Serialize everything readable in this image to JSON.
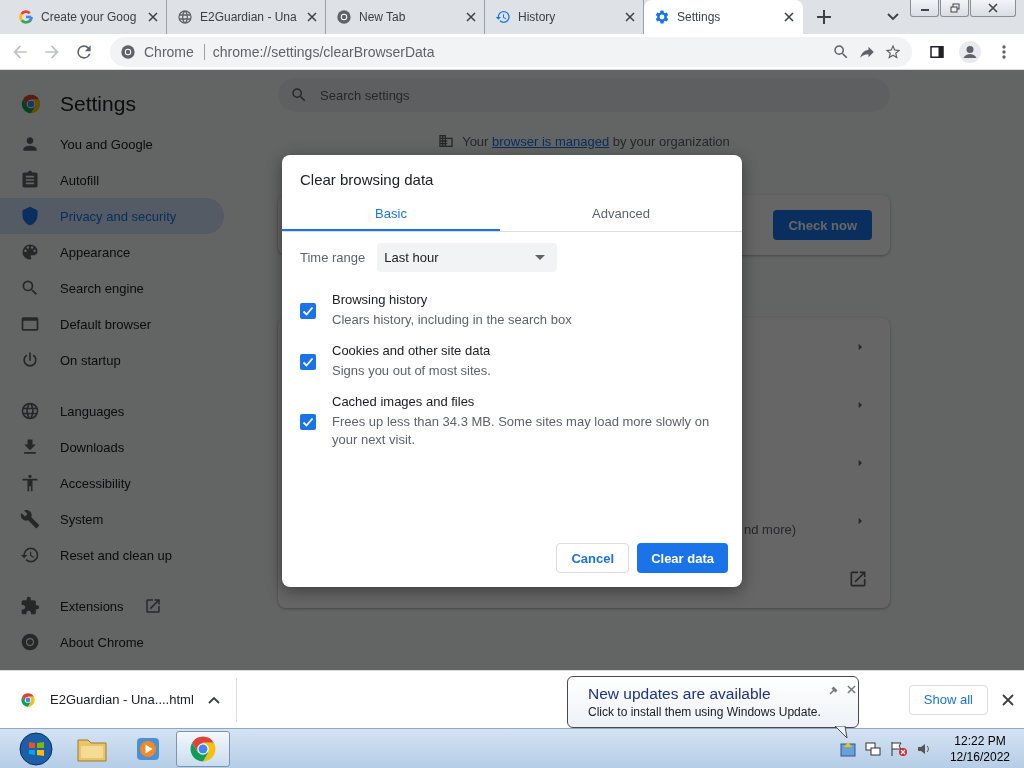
{
  "browser": {
    "tabs": [
      {
        "title": "Create your Goog",
        "selected": false
      },
      {
        "title": "E2Guardian - Una",
        "selected": false
      },
      {
        "title": "New Tab",
        "selected": false
      },
      {
        "title": "History",
        "selected": false
      },
      {
        "title": "Settings",
        "selected": true
      }
    ],
    "address": {
      "chip": "Chrome",
      "url": "chrome://settings/clearBrowserData"
    }
  },
  "settings": {
    "title": "Settings",
    "search": {
      "placeholder": "Search settings"
    },
    "sidebar": {
      "sections": [
        [
          {
            "label": "You and Google",
            "selected": false
          },
          {
            "label": "Autofill",
            "selected": false
          },
          {
            "label": "Privacy and security",
            "selected": true
          },
          {
            "label": "Appearance",
            "selected": false
          },
          {
            "label": "Search engine",
            "selected": false
          },
          {
            "label": "Default browser",
            "selected": false
          },
          {
            "label": "On startup",
            "selected": false
          }
        ],
        [
          {
            "label": "Languages",
            "selected": false
          },
          {
            "label": "Downloads",
            "selected": false
          },
          {
            "label": "Accessibility",
            "selected": false
          },
          {
            "label": "System",
            "selected": false
          },
          {
            "label": "Reset and clean up",
            "selected": false
          }
        ],
        [
          {
            "label": "Extensions",
            "selected": false
          },
          {
            "label": "About Chrome",
            "selected": false
          }
        ]
      ]
    },
    "managed_notice": {
      "before": "Your",
      "link": "browser is managed",
      "after": "by your organization"
    },
    "safety_check_button": "Check now",
    "partial_text": "nd more)"
  },
  "dialog": {
    "title": "Clear browsing data",
    "tabs": [
      {
        "label": "Basic",
        "selected": true
      },
      {
        "label": "Advanced",
        "selected": false
      }
    ],
    "time_range": {
      "label": "Time range",
      "value": "Last hour"
    },
    "options": [
      {
        "title": "Browsing history",
        "description": "Clears history, including in the search box",
        "checked": true
      },
      {
        "title": "Cookies and other site data",
        "description": "Signs you out of most sites.",
        "checked": true
      },
      {
        "title": "Cached images and files",
        "description": "Frees up less than 34.3 MB. Some sites may load more slowly on your next visit.",
        "checked": true
      }
    ],
    "cancel": "Cancel",
    "confirm": "Clear data"
  },
  "download_shelf": {
    "file": "E2Guardian - Una....html",
    "show_all": "Show all"
  },
  "notification": {
    "title": "New updates are available",
    "body": "Click to install them using Windows Update."
  },
  "taskbar": {
    "time": "12:22 PM",
    "date": "12/16/2022"
  }
}
